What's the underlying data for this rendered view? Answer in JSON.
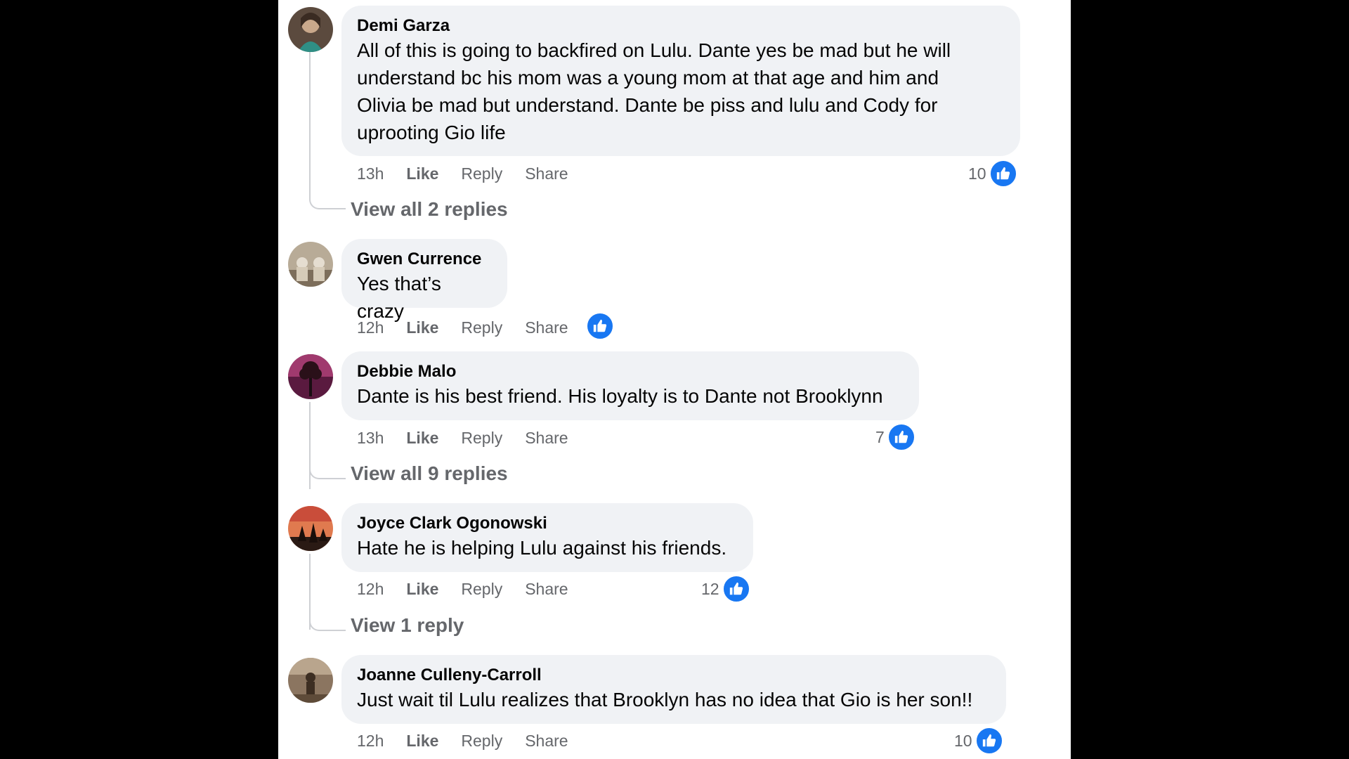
{
  "comments": [
    {
      "author": "Demi Garza",
      "lines": [
        "All of this is going to backfired on Lulu. Dante yes be mad but he will",
        "understand bc his mom was a young mom at that age and him and",
        "Olivia be mad but understand. Dante be piss and lulu and Cody for",
        "uprooting Gio life"
      ],
      "time": "13h",
      "like": "Like",
      "reply": "Reply",
      "share": "Share",
      "reactions": "10",
      "replies": "View all 2 replies",
      "avatar_color": "#4a6b5a"
    },
    {
      "author": "Gwen Currence",
      "lines": [
        "Yes that’s crazy"
      ],
      "time": "12h",
      "like": "Like",
      "reply": "Reply",
      "share": "Share",
      "reactions": "",
      "avatar_color": "#9c8f7e"
    },
    {
      "author": "Debbie Malo",
      "lines": [
        "Dante is his best friend. His loyalty is to Dante not Brooklynn"
      ],
      "time": "13h",
      "like": "Like",
      "reply": "Reply",
      "share": "Share",
      "reactions": "7",
      "replies": "View all 9 replies",
      "avatar_color": "#7a2a5a"
    },
    {
      "author": "Joyce Clark Ogonowski",
      "lines": [
        "Hate he is helping Lulu against his friends."
      ],
      "time": "12h",
      "like": "Like",
      "reply": "Reply",
      "share": "Share",
      "reactions": "12",
      "replies": "View 1 reply",
      "avatar_color": "#c8563a"
    },
    {
      "author": "Joanne Culleny-Carroll",
      "lines": [
        "Just wait til Lulu realizes that Brooklyn has no idea that Gio is her son!!"
      ],
      "time": "12h",
      "like": "Like",
      "reply": "Reply",
      "share": "Share",
      "reactions": "10",
      "avatar_color": "#6b5a48"
    }
  ],
  "icons": {
    "like_badge": "thumbs-up-icon"
  },
  "colors": {
    "like_blue": "#1877f2",
    "bubble_bg": "#f0f2f5",
    "meta_gray": "#65676b"
  }
}
